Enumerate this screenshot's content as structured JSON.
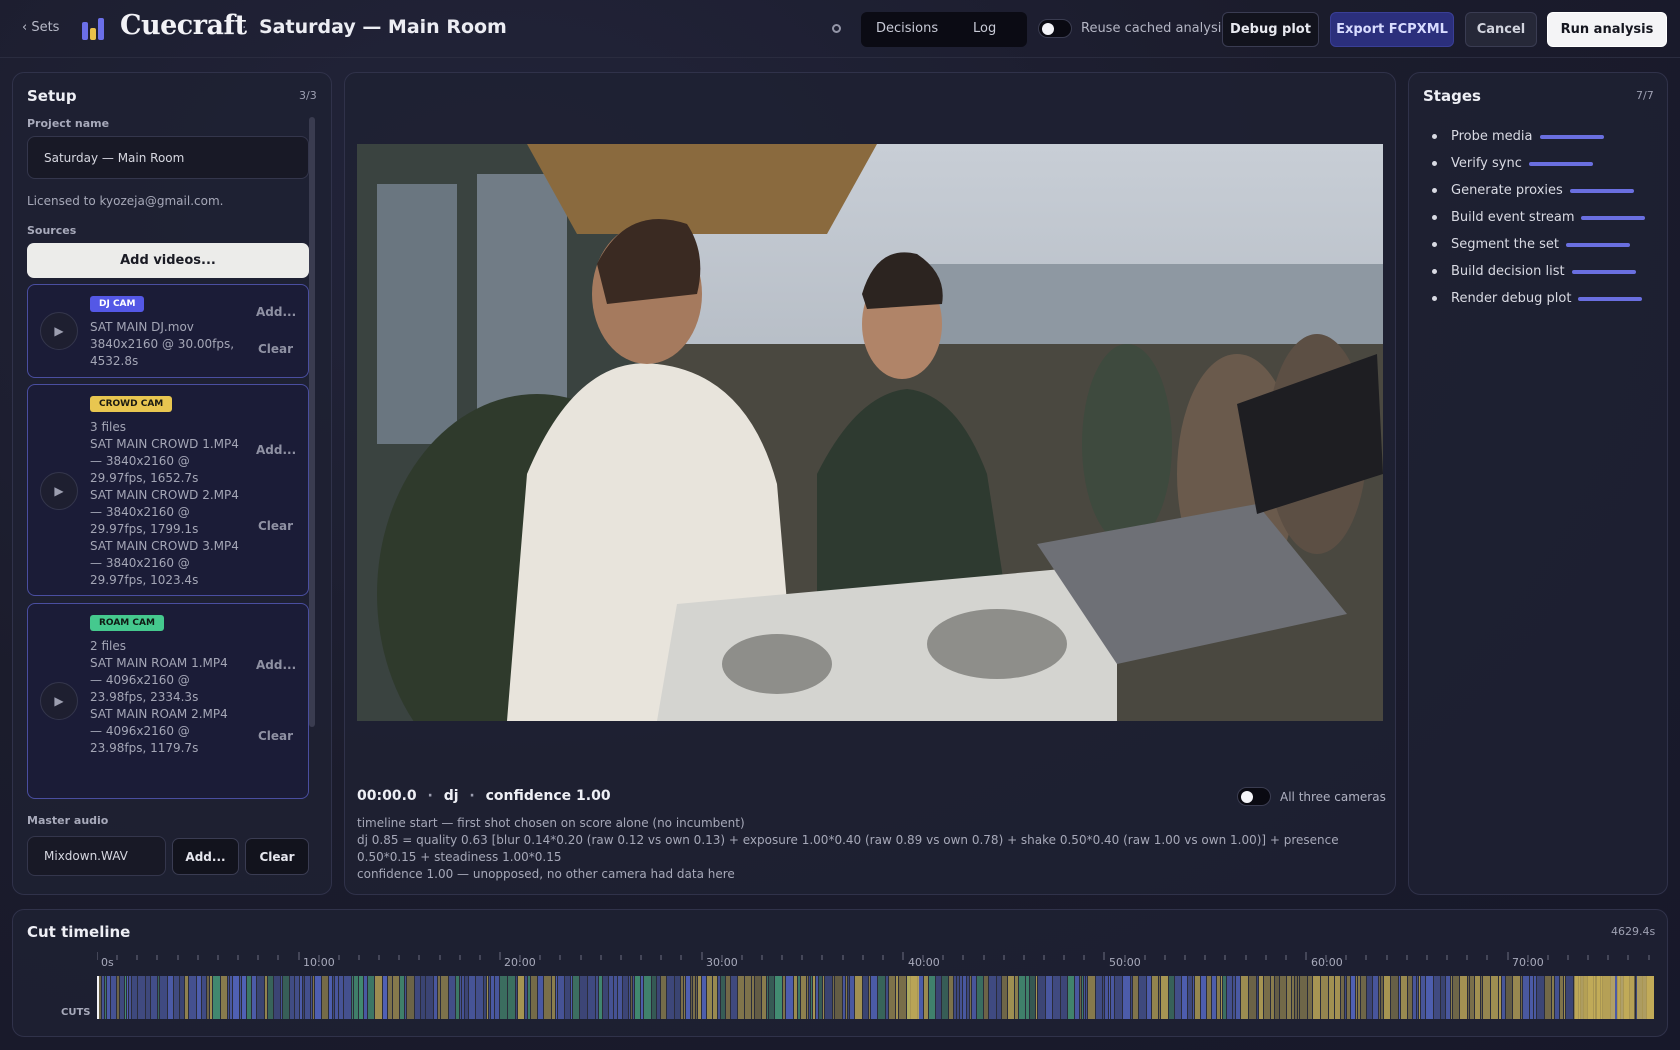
{
  "topbar": {
    "back_label": "‹ Sets",
    "brand": "Cuecraft",
    "separator": "·",
    "project_title": "Saturday — Main Room",
    "tabs": [
      {
        "label": "Decisions"
      },
      {
        "label": "Log"
      }
    ],
    "reuse_label": "Reuse cached analysis",
    "debug_plot": "Debug plot",
    "export": "Export FCPXML",
    "cancel": "Cancel",
    "run": "Run analysis",
    "brand_colors": [
      "#6b6fe8",
      "#e8c04a",
      "#4ac08a"
    ]
  },
  "setup": {
    "title": "Setup",
    "count": "3/3",
    "project_name_label": "Project name",
    "project_name_value": "Saturday — Main Room",
    "licensed": "Licensed to kyozeja@gmail.com.",
    "sources_label": "Sources",
    "add_videos": "Add videos...",
    "cameras": [
      {
        "badge": "DJ CAM",
        "badge_color": "#5458e6",
        "summary": "",
        "lines": [
          "SAT MAIN DJ.mov",
          "3840x2160 @ 30.00fps,",
          "4532.8s"
        ],
        "add": "Add...",
        "clear": "Clear"
      },
      {
        "badge": "CROWD CAM",
        "badge_color": "#e8c650",
        "summary": "3 files",
        "lines": [
          "SAT MAIN CROWD 1.MP4",
          "— 3840x2160 @",
          "29.97fps, 1652.7s",
          "SAT MAIN CROWD 2.MP4",
          "— 3840x2160 @",
          "29.97fps, 1799.1s",
          "SAT MAIN CROWD 3.MP4",
          "— 3840x2160 @",
          "29.97fps, 1023.4s"
        ],
        "add": "Add...",
        "clear": "Clear"
      },
      {
        "badge": "ROAM CAM",
        "badge_color": "#45c98e",
        "summary": "2 files",
        "lines": [
          "SAT MAIN ROAM 1.MP4",
          "— 4096x2160 @",
          "23.98fps, 2334.3s",
          "SAT MAIN ROAM 2.MP4",
          "— 4096x2160 @",
          "23.98fps, 1179.7s"
        ],
        "add": "Add...",
        "clear": "Clear"
      }
    ],
    "master_audio_label": "Master audio",
    "master_audio_value": "Mixdown.WAV",
    "master_add": "Add...",
    "master_clear": "Clear"
  },
  "preview": {
    "timecode": "00:00.0",
    "camera": "dj",
    "confidence": "confidence 1.00",
    "dot": "·",
    "all_three_label": "All three cameras",
    "explain": [
      "timeline start — first shot chosen on score alone (no incumbent)",
      "dj 0.85 = quality 0.63 [blur 0.14*0.20 (raw 0.12 vs own 0.13) + exposure 1.00*0.40 (raw 0.89 vs own 0.78) + shake 0.50*0.40 (raw 1.00 vs own 1.00)] + presence 0.50*0.15 + steadiness 1.00*0.15",
      "confidence 1.00 — unopposed, no other camera had data here"
    ]
  },
  "stages": {
    "title": "Stages",
    "count": "7/7",
    "items": [
      {
        "label": "Probe media",
        "progress": 1.0
      },
      {
        "label": "Verify sync",
        "progress": 1.0
      },
      {
        "label": "Generate proxies",
        "progress": 1.0
      },
      {
        "label": "Build event stream",
        "progress": 1.0
      },
      {
        "label": "Segment the set",
        "progress": 1.0
      },
      {
        "label": "Build decision list",
        "progress": 1.0
      },
      {
        "label": "Render debug plot",
        "progress": 1.0
      }
    ]
  },
  "timeline": {
    "title": "Cut timeline",
    "duration": "4629.4s",
    "cuts_label": "CUTS",
    "tick_labels": [
      "0s",
      "10:00",
      "20:00",
      "30:00",
      "40:00",
      "50:00",
      "60:00",
      "70:00"
    ],
    "camera_colors": {
      "dj": "#5a6fd6",
      "crowd": "#c9b25a",
      "roam": "#4aa882"
    }
  }
}
